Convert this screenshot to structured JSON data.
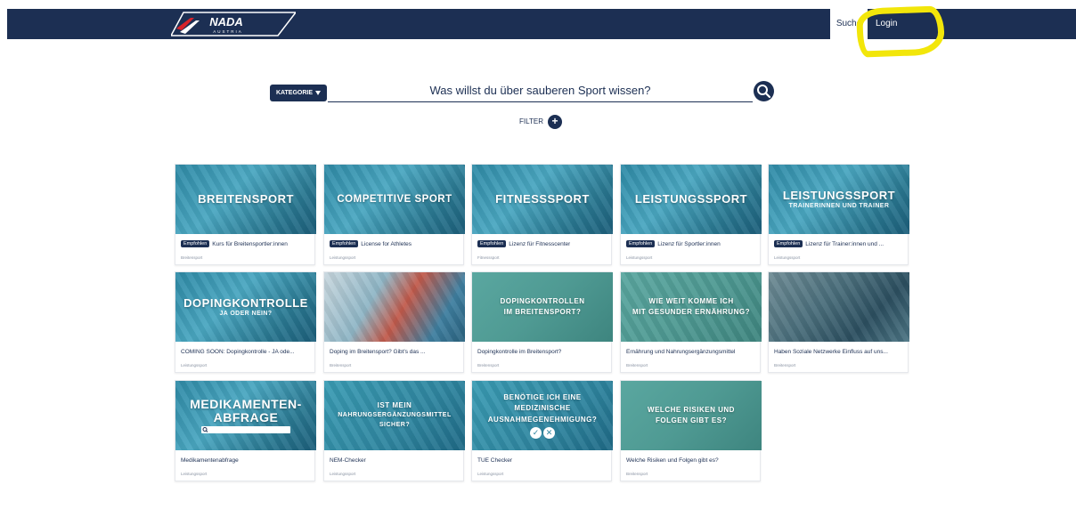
{
  "header": {
    "logo_text": "NADA",
    "logo_sub": "AUSTRIA",
    "nav": [
      {
        "label": "Suche"
      },
      {
        "label": "Login"
      }
    ]
  },
  "search": {
    "category_label": "KATEGORIE",
    "prompt": "Was willst du über sauberen Sport wissen?",
    "filter_label": "FILTER"
  },
  "colors": {
    "navy": "#1c2f53",
    "highlight": "#f2e60a",
    "card_teal": "#2f86a0"
  },
  "cards": [
    {
      "thumb_line1": "BREITENSPORT",
      "thumb_line2": "",
      "badge": "Empfohlen",
      "title": "Kurs für Breitensportler:innen",
      "category": "Breitensport"
    },
    {
      "thumb_line1": "COMPETITIVE SPORT",
      "thumb_line2": "",
      "badge": "Empfohlen",
      "title": "License for Athletes",
      "category": "Leistungssport"
    },
    {
      "thumb_line1": "FITNESSSPORT",
      "thumb_line2": "",
      "badge": "Empfohlen",
      "title": "Lizenz für Fitnesscenter",
      "category": "Fitnesssport"
    },
    {
      "thumb_line1": "LEISTUNGSSPORT",
      "thumb_line2": "",
      "badge": "Empfohlen",
      "title": "Lizenz für Sportler:innen",
      "category": "Leistungssport"
    },
    {
      "thumb_line1": "LEISTUNGSSPORT",
      "thumb_line2": "TRAINERINNEN UND TRAINER",
      "badge": "Empfohlen",
      "title": "Lizenz für Trainer:innen und ...",
      "category": "Leistungssport"
    },
    {
      "thumb_line1": "DOPINGKONTROLLE",
      "thumb_line2": "JA ODER NEIN?",
      "badge": "",
      "title": "COMING SOON: Dopingkontrolle - JA ode...",
      "category": "Leistungssport"
    },
    {
      "thumb_line1": "",
      "thumb_line2": "",
      "badge": "",
      "title": "Doping im Breitensport? Gibt's das ...",
      "category": "Breitensport"
    },
    {
      "thumb_line1": "DOPINGKONTROLLEN",
      "thumb_line2": "IM BREITENSPORT?",
      "badge": "",
      "title": "Dopingkontrolle im Breitensport?",
      "category": "Breitensport"
    },
    {
      "thumb_line1": "WIE WEIT KOMME ICH",
      "thumb_line2": "MIT GESUNDER ERNÄHRUNG?",
      "badge": "",
      "title": "Ernährung und Nahrungsergänzungsmittel",
      "category": "Breitensport"
    },
    {
      "thumb_line1": "",
      "thumb_line2": "",
      "badge": "",
      "title": "Haben Soziale Netzwerke Einfluss auf uns...",
      "category": "Breitensport"
    },
    {
      "thumb_line1": "MEDIKAMENTEN-",
      "thumb_line2": "ABFRAGE",
      "badge": "",
      "title": "Medikamentenabfrage",
      "category": "Leistungssport"
    },
    {
      "thumb_line1": "IST MEIN",
      "thumb_line2": "NAHRUNGSERGÄNZUNGSMITTEL SICHER?",
      "badge": "",
      "title": "NEM-Checker",
      "category": "Leistungssport"
    },
    {
      "thumb_line1": "BENÖTIGE ICH EINE MEDIZINISCHE",
      "thumb_line2": "AUSNAHMEGENEHMIGUNG?",
      "badge": "",
      "title": "TUE Checker",
      "category": "Leistungssport"
    },
    {
      "thumb_line1": "WELCHE RISIKEN UND",
      "thumb_line2": "FOLGEN GIBT ES?",
      "badge": "",
      "title": "Welche Risiken und Folgen gibt es?",
      "category": "Breitensport"
    }
  ]
}
